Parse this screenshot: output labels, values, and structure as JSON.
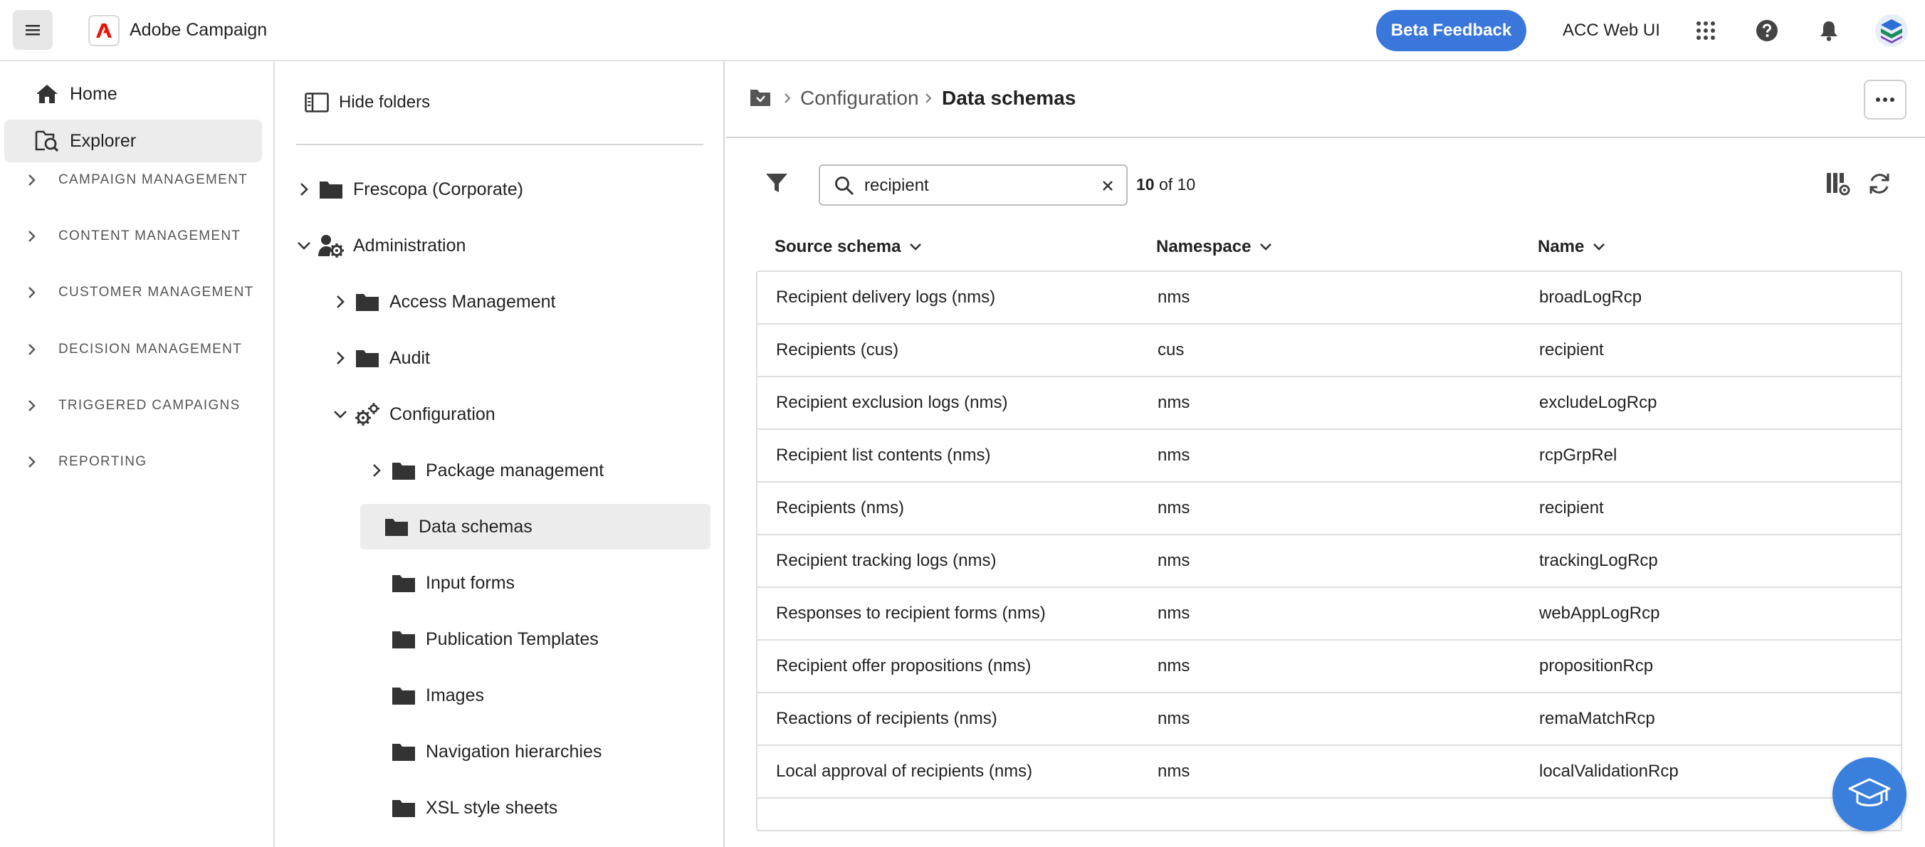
{
  "header": {
    "app_title": "Adobe Campaign",
    "beta_feedback": "Beta Feedback",
    "acc_web_ui": "ACC Web UI",
    "brand_color": "#eb1000",
    "accent_color": "#3a77db"
  },
  "leftnav": {
    "items": [
      {
        "label": "Home",
        "icon": "home-icon"
      },
      {
        "label": "Explorer",
        "icon": "explorer-icon",
        "selected": true
      }
    ],
    "sections": [
      {
        "label": "CAMPAIGN MANAGEMENT"
      },
      {
        "label": "CONTENT MANAGEMENT"
      },
      {
        "label": "CUSTOMER MANAGEMENT"
      },
      {
        "label": "DECISION MANAGEMENT"
      },
      {
        "label": "TRIGGERED CAMPAIGNS"
      },
      {
        "label": "REPORTING"
      }
    ]
  },
  "folders": {
    "hide_label": "Hide folders",
    "tree": [
      {
        "label": "Frescopa (Corporate)",
        "level": 0,
        "expand": "collapsed",
        "icon": "folder-icon"
      },
      {
        "label": "Administration",
        "level": 0,
        "expand": "expanded",
        "icon": "admin-gear-icon"
      },
      {
        "label": "Access Management",
        "level": 1,
        "expand": "collapsed",
        "icon": "folder-icon"
      },
      {
        "label": "Audit",
        "level": 1,
        "expand": "collapsed",
        "icon": "folder-icon"
      },
      {
        "label": "Configuration",
        "level": 1,
        "expand": "expanded",
        "icon": "gears-icon"
      },
      {
        "label": "Package management",
        "level": 2,
        "expand": "collapsed",
        "icon": "folder-icon"
      },
      {
        "label": "Data schemas",
        "level": 2,
        "expand": "none",
        "icon": "folder-icon",
        "selected": true
      },
      {
        "label": "Input forms",
        "level": 2,
        "expand": "none",
        "icon": "folder-icon"
      },
      {
        "label": "Publication Templates",
        "level": 2,
        "expand": "none",
        "icon": "folder-icon"
      },
      {
        "label": "Images",
        "level": 2,
        "expand": "none",
        "icon": "folder-icon"
      },
      {
        "label": "Navigation hierarchies",
        "level": 2,
        "expand": "none",
        "icon": "folder-icon"
      },
      {
        "label": "XSL style sheets",
        "level": 2,
        "expand": "none",
        "icon": "folder-icon"
      }
    ]
  },
  "breadcrumb": {
    "parent": "Configuration",
    "current": "Data schemas"
  },
  "toolbar": {
    "search_value": "recipient",
    "count_shown": "10",
    "count_total": "of 10"
  },
  "table": {
    "headers": [
      "Source schema",
      "Namespace",
      "Name"
    ],
    "rows": [
      [
        "Recipient delivery logs (nms)",
        "nms",
        "broadLogRcp"
      ],
      [
        "Recipients (cus)",
        "cus",
        "recipient"
      ],
      [
        "Recipient exclusion logs (nms)",
        "nms",
        "excludeLogRcp"
      ],
      [
        "Recipient list contents (nms)",
        "nms",
        "rcpGrpRel"
      ],
      [
        "Recipients (nms)",
        "nms",
        "recipient"
      ],
      [
        "Recipient tracking logs (nms)",
        "nms",
        "trackingLogRcp"
      ],
      [
        "Responses to recipient forms (nms)",
        "nms",
        "webAppLogRcp"
      ],
      [
        "Recipient offer propositions (nms)",
        "nms",
        "propositionRcp"
      ],
      [
        "Reactions of recipients (nms)",
        "nms",
        "remaMatchRcp"
      ],
      [
        "Local approval of recipients (nms)",
        "nms",
        "localValidationRcp"
      ]
    ]
  }
}
